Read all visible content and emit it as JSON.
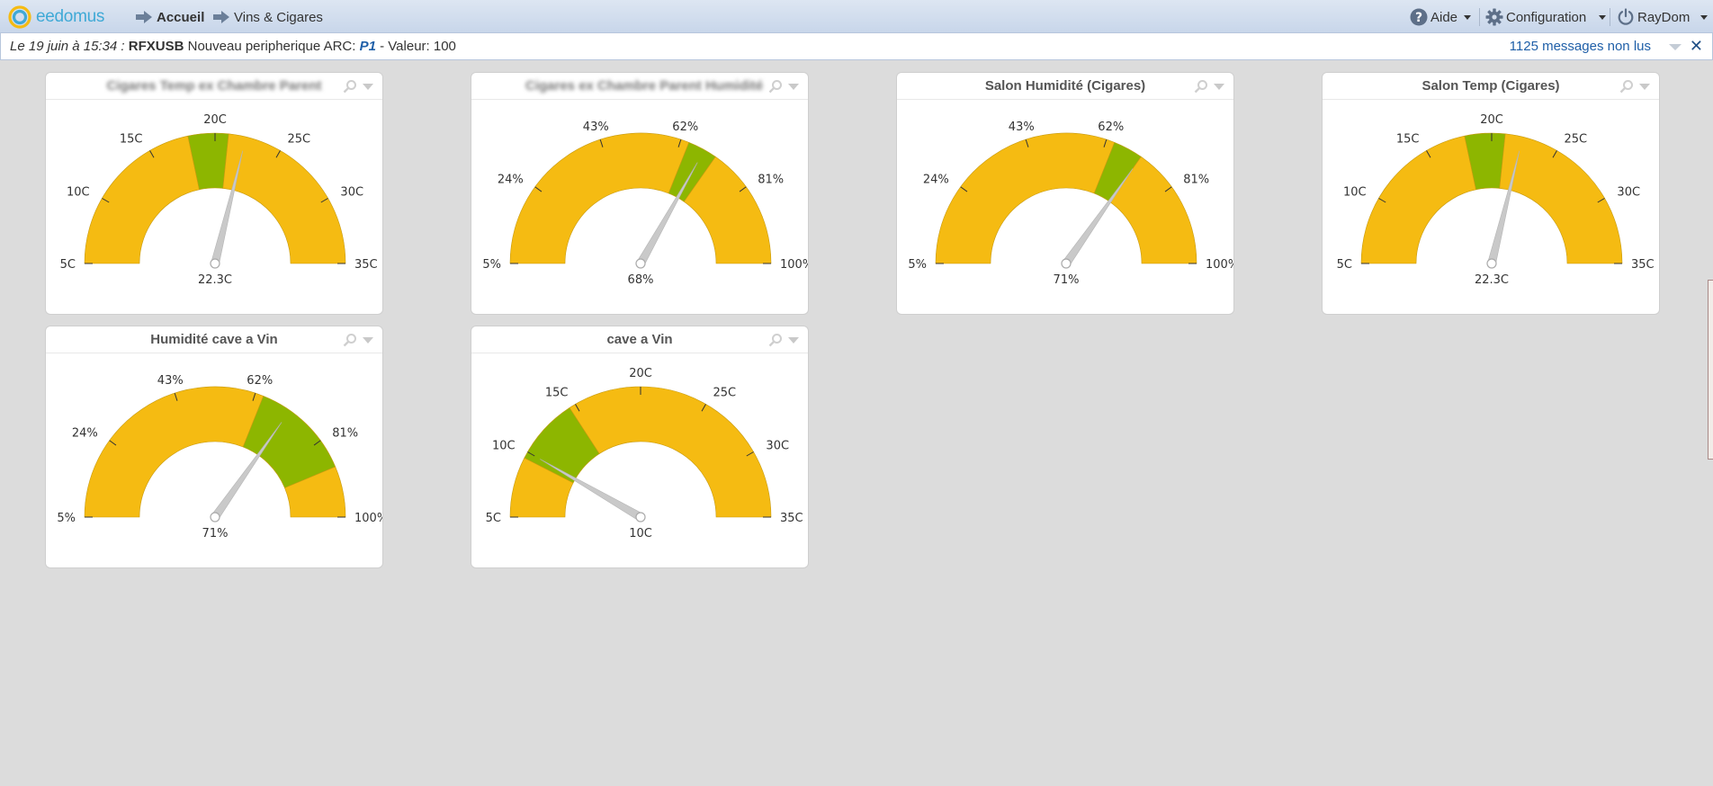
{
  "app": {
    "logo_text": "eedomus"
  },
  "nav": [
    {
      "label": "Accueil",
      "bold": true
    },
    {
      "label": "Vins & Cigares",
      "bold": false
    }
  ],
  "right_menu": {
    "help": "Aide",
    "config": "Configuration",
    "user": "RayDom"
  },
  "message": {
    "date": "Le 19 juin à 15:34 :",
    "device": "RFXUSB",
    "text": "Nouveau peripherique ARC:",
    "peripheral": "P1",
    "value_text": "- Valeur: 100",
    "unread": "1125 messages non lus"
  },
  "chart_data": [
    {
      "type": "gauge",
      "title": "Cigares Temp ex Chambre Parent",
      "blurred": true,
      "min": 5,
      "max": 35,
      "ticks": [
        5,
        10,
        15,
        20,
        25,
        30,
        35
      ],
      "tick_labels": [
        "5C",
        "10C",
        "15C",
        "20C",
        "25C",
        "30C",
        "35C"
      ],
      "bands": [
        {
          "from": 5,
          "to": 18,
          "color": "#f5bb12"
        },
        {
          "from": 18,
          "to": 21,
          "color": "#8db600"
        },
        {
          "from": 21,
          "to": 35,
          "color": "#f5bb12"
        }
      ],
      "value": 22.3,
      "value_label": "22.3C"
    },
    {
      "type": "gauge",
      "title": "Cigares ex Chambre Parent Humidité",
      "blurred": true,
      "min": 5,
      "max": 100,
      "ticks": [
        5,
        24,
        43,
        62,
        81,
        100
      ],
      "tick_labels": [
        "5%",
        "24%",
        "43%",
        "62%",
        "81%",
        "100%"
      ],
      "bands": [
        {
          "from": 5,
          "to": 64,
          "color": "#f5bb12"
        },
        {
          "from": 64,
          "to": 71,
          "color": "#8db600"
        },
        {
          "from": 71,
          "to": 100,
          "color": "#f5bb12"
        }
      ],
      "value": 68,
      "value_label": "68%"
    },
    {
      "type": "gauge",
      "title": "Salon Humidité (Cigares)",
      "blurred": false,
      "min": 5,
      "max": 100,
      "ticks": [
        5,
        24,
        43,
        62,
        81,
        100
      ],
      "tick_labels": [
        "5%",
        "24%",
        "43%",
        "62%",
        "81%",
        "100%"
      ],
      "bands": [
        {
          "from": 5,
          "to": 64,
          "color": "#f5bb12"
        },
        {
          "from": 64,
          "to": 71,
          "color": "#8db600"
        },
        {
          "from": 71,
          "to": 100,
          "color": "#f5bb12"
        }
      ],
      "value": 71,
      "value_label": "71%"
    },
    {
      "type": "gauge",
      "title": "Salon Temp (Cigares)",
      "blurred": false,
      "min": 5,
      "max": 35,
      "ticks": [
        5,
        10,
        15,
        20,
        25,
        30,
        35
      ],
      "tick_labels": [
        "5C",
        "10C",
        "15C",
        "20C",
        "25C",
        "30C",
        "35C"
      ],
      "bands": [
        {
          "from": 5,
          "to": 18,
          "color": "#f5bb12"
        },
        {
          "from": 18,
          "to": 21,
          "color": "#8db600"
        },
        {
          "from": 21,
          "to": 35,
          "color": "#f5bb12"
        }
      ],
      "value": 22.3,
      "value_label": "22.3C"
    },
    {
      "type": "gauge",
      "title": "Humidité cave a Vin",
      "blurred": false,
      "min": 5,
      "max": 100,
      "ticks": [
        5,
        24,
        43,
        62,
        81,
        100
      ],
      "tick_labels": [
        "5%",
        "24%",
        "43%",
        "62%",
        "81%",
        "100%"
      ],
      "bands": [
        {
          "from": 5,
          "to": 64,
          "color": "#f5bb12"
        },
        {
          "from": 64,
          "to": 88,
          "color": "#8db600"
        },
        {
          "from": 88,
          "to": 100,
          "color": "#f5bb12"
        }
      ],
      "value": 71,
      "value_label": "71%"
    },
    {
      "type": "gauge",
      "title": "cave a Vin",
      "blurred": false,
      "min": 5,
      "max": 35,
      "ticks": [
        5,
        10,
        15,
        20,
        25,
        30,
        35
      ],
      "tick_labels": [
        "5C",
        "10C",
        "15C",
        "20C",
        "25C",
        "30C",
        "35C"
      ],
      "bands": [
        {
          "from": 5,
          "to": 9.5,
          "color": "#f5bb12"
        },
        {
          "from": 9.5,
          "to": 14.5,
          "color": "#8db600"
        },
        {
          "from": 14.5,
          "to": 35,
          "color": "#f5bb12"
        }
      ],
      "value": 10,
      "value_label": "10C"
    }
  ]
}
